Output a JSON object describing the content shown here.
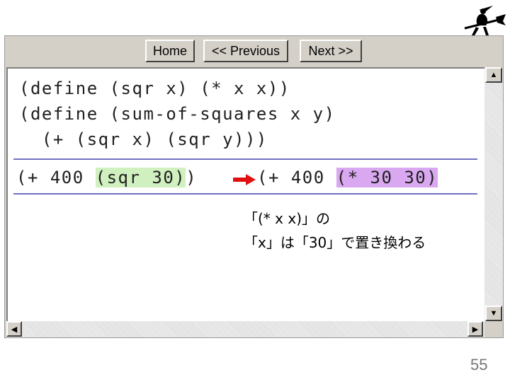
{
  "toolbar": {
    "home_label": "Home",
    "previous_label": "<< Previous",
    "next_label": "Next >>"
  },
  "code": {
    "line1": "(define (sqr x) (* x x))",
    "line2": "(define (sum-of-squares x y)",
    "line3": "  (+ (sqr x) (sqr y)))"
  },
  "eval": {
    "before_prefix": "(+ 400 ",
    "before_highlight": "(sqr 30)",
    "before_suffix": ")",
    "after_prefix": "(+ 400 ",
    "after_highlight": "(* 30 30)"
  },
  "note": {
    "line1": "「(* x x)」の",
    "line2": "「x」は「30」で置き換わる"
  },
  "page_number": "55",
  "colors": {
    "highlight_green": "#d0f0c0",
    "highlight_purple": "#d9a8f0",
    "separator": "#7070c0",
    "arrow": "#e01010"
  }
}
